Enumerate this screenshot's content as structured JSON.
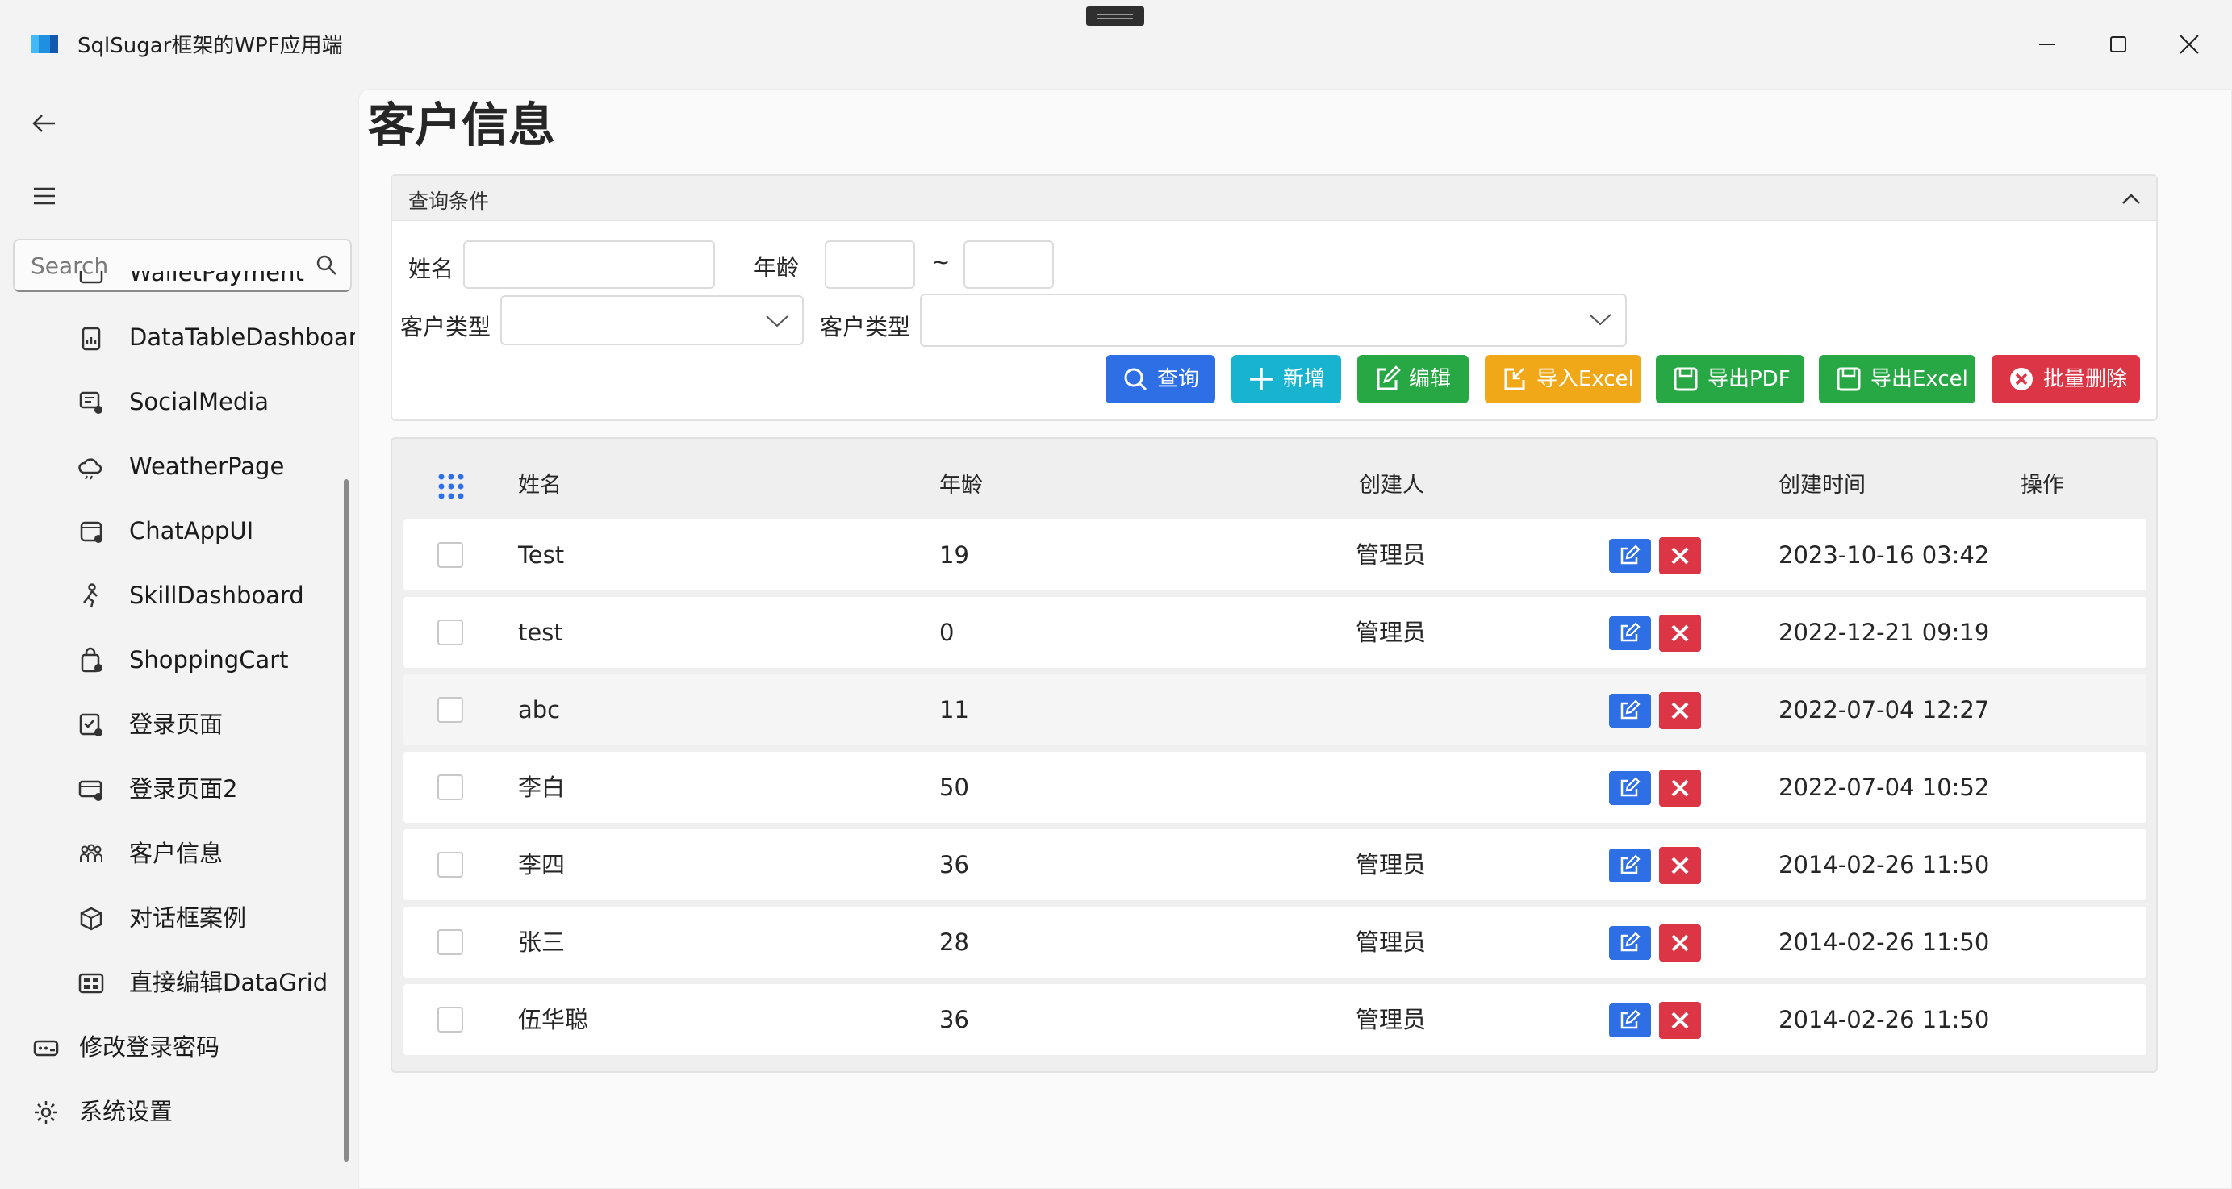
{
  "window": {
    "title": "SqlSugar框架的WPF应用端",
    "brand_colors": [
      "#1e8fe1",
      "#43b9f5",
      "#1558b0"
    ]
  },
  "sidebar": {
    "search_placeholder": "Search",
    "items": [
      {
        "label": "WalletPayment",
        "icon": "wallet-icon"
      },
      {
        "label": "DataTableDashboard",
        "icon": "clipboard-chart-icon"
      },
      {
        "label": "SocialMedia",
        "icon": "chat-person-icon"
      },
      {
        "label": "WeatherPage",
        "icon": "weather-cloud-icon"
      },
      {
        "label": "ChatAppUI",
        "icon": "chat-app-icon"
      },
      {
        "label": "SkillDashboard",
        "icon": "person-run-icon"
      },
      {
        "label": "ShoppingCart",
        "icon": "shopping-bag-icon"
      },
      {
        "label": "登录页面",
        "icon": "checklist-person-icon"
      },
      {
        "label": "登录页面2",
        "icon": "card-person-icon"
      },
      {
        "label": "客户信息",
        "icon": "people-group-icon"
      },
      {
        "label": "对话框案例",
        "icon": "cube-icon"
      },
      {
        "label": "直接编辑DataGrid",
        "icon": "grid-icon"
      }
    ],
    "footer_items": [
      {
        "label": "修改登录密码",
        "icon": "password-icon"
      },
      {
        "label": "系统设置",
        "icon": "gear-icon"
      }
    ]
  },
  "page": {
    "title": "客户信息"
  },
  "query": {
    "header": "查询条件",
    "name_label": "姓名",
    "name_value": "",
    "age_label": "年龄",
    "age_from": "",
    "age_sep": "~",
    "age_to": "",
    "type_label_1": "客户类型",
    "type_value_1": "",
    "type_label_2": "客户类型",
    "type_value_2": ""
  },
  "buttons": {
    "search": "查询",
    "add": "新增",
    "edit": "编辑",
    "import_excel": "导入Excel",
    "export_pdf": "导出PDF",
    "export_excel": "导出Excel",
    "batch_delete": "批量删除"
  },
  "button_colors": {
    "search": "#2f6fe6",
    "add": "#17b3cf",
    "edit": "#28a745",
    "import_excel": "#f0a818",
    "export_pdf": "#28a745",
    "export_excel": "#28a745",
    "batch_delete": "#dc3545"
  },
  "grid": {
    "columns": [
      "姓名",
      "年龄",
      "创建人",
      "创建时间",
      "操作"
    ],
    "rows": [
      {
        "name": "Test",
        "age": "19",
        "creator": "管理员",
        "created": "2023-10-16 03:42"
      },
      {
        "name": "test",
        "age": "0",
        "creator": "管理员",
        "created": "2022-12-21 09:19"
      },
      {
        "name": "abc",
        "age": "11",
        "creator": "",
        "created": "2022-07-04 12:27"
      },
      {
        "name": "李白",
        "age": "50",
        "creator": "",
        "created": "2022-07-04 10:52"
      },
      {
        "name": "李四",
        "age": "36",
        "creator": "管理员",
        "created": "2014-02-26 11:50"
      },
      {
        "name": "张三",
        "age": "28",
        "creator": "管理员",
        "created": "2014-02-26 11:50"
      },
      {
        "name": "伍华聪",
        "age": "36",
        "creator": "管理员",
        "created": "2014-02-26 11:50"
      }
    ]
  }
}
